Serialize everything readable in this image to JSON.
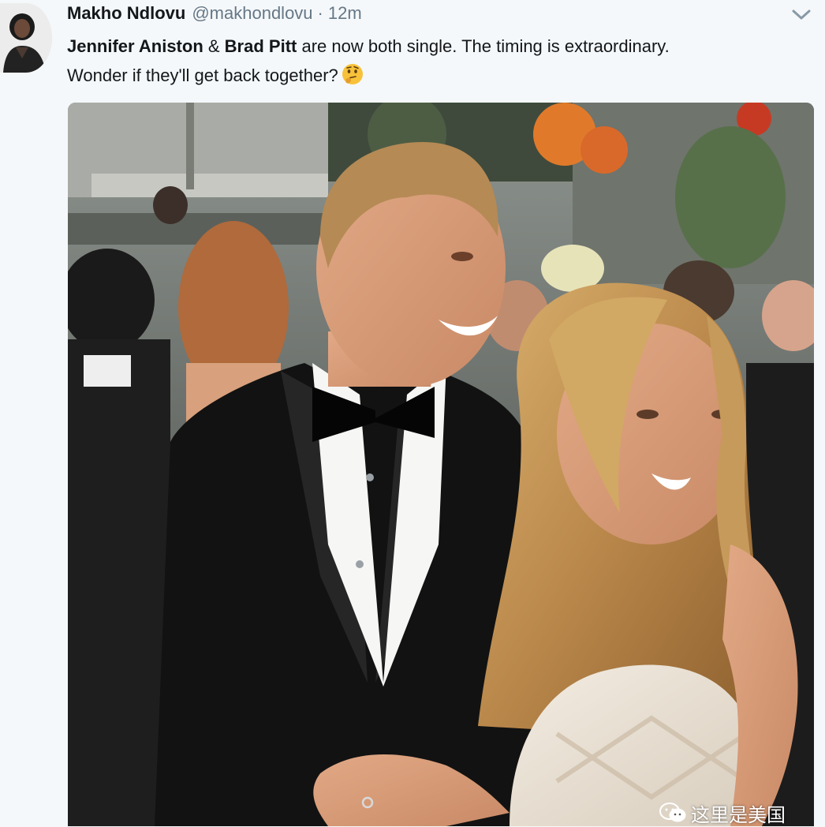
{
  "tweet": {
    "author_name": "Makho Ndlovu",
    "author_handle": "@makhondlovu",
    "separator": "·",
    "timestamp": "12m",
    "text": {
      "mention_1": "Jennifer Aniston",
      "connector_1": " & ",
      "mention_2": "Brad Pitt",
      "line_1_rest": " are now both single. The timing is extraordinary.",
      "line_2": "Wonder if they'll get back together?"
    },
    "emoji_name": "thinking-face-emoji",
    "menu_icon": "chevron-down-icon"
  },
  "photo": {
    "subject": "couple-at-red-carpet-photo"
  },
  "watermark": {
    "text": "这里是美国",
    "icon": "wechat-icon"
  },
  "colors": {
    "background": "#f5f8fa",
    "text": "#14171a",
    "secondary_text": "#657786"
  }
}
